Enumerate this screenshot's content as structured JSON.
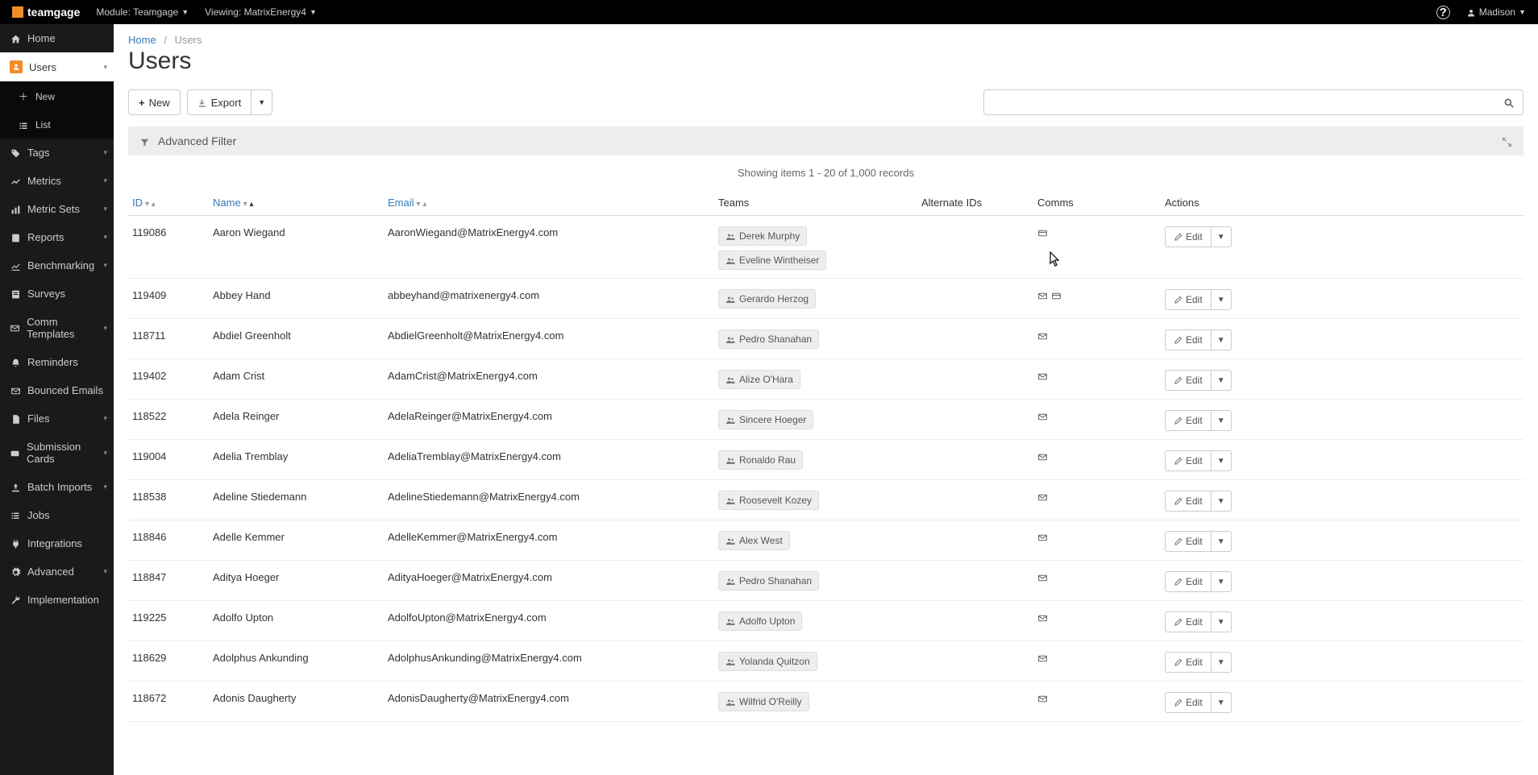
{
  "topbar": {
    "brand": "teamgage",
    "module_label": "Module: Teamgage",
    "viewing_label": "Viewing: MatrixEnergy4",
    "user_name": "Madison"
  },
  "sidebar": {
    "home": "Home",
    "users": "Users",
    "new": "New",
    "list": "List",
    "tags": "Tags",
    "metrics": "Metrics",
    "metric_sets": "Metric Sets",
    "reports": "Reports",
    "benchmarking": "Benchmarking",
    "surveys": "Surveys",
    "comm_templates": "Comm Templates",
    "reminders": "Reminders",
    "bounced_emails": "Bounced Emails",
    "files": "Files",
    "submission_cards": "Submission Cards",
    "batch_imports": "Batch Imports",
    "jobs": "Jobs",
    "integrations": "Integrations",
    "advanced": "Advanced",
    "implementation": "Implementation"
  },
  "breadcrumb": {
    "home": "Home",
    "current": "Users"
  },
  "page_title": "Users",
  "toolbar": {
    "new": "New",
    "export": "Export"
  },
  "filter": {
    "label": "Advanced Filter"
  },
  "records_info": "Showing items 1 - 20 of 1,000 records",
  "columns": {
    "id": "ID",
    "name": "Name",
    "email": "Email",
    "teams": "Teams",
    "altids": "Alternate IDs",
    "comms": "Comms",
    "actions": "Actions"
  },
  "edit_label": "Edit",
  "rows": [
    {
      "id": "119086",
      "name": "Aaron Wiegand",
      "email": "AaronWiegand@MatrixEnergy4.com",
      "teams": [
        "Derek Murphy",
        "Eveline Wintheiser"
      ],
      "comms": [
        "card"
      ]
    },
    {
      "id": "119409",
      "name": "Abbey Hand",
      "email": "abbeyhand@matrixenergy4.com",
      "teams": [
        "Gerardo Herzog"
      ],
      "comms": [
        "mail",
        "card"
      ]
    },
    {
      "id": "118711",
      "name": "Abdiel Greenholt",
      "email": "AbdielGreenholt@MatrixEnergy4.com",
      "teams": [
        "Pedro Shanahan"
      ],
      "comms": [
        "mail"
      ]
    },
    {
      "id": "119402",
      "name": "Adam Crist",
      "email": "AdamCrist@MatrixEnergy4.com",
      "teams": [
        "Alize O'Hara"
      ],
      "comms": [
        "mail"
      ]
    },
    {
      "id": "118522",
      "name": "Adela Reinger",
      "email": "AdelaReinger@MatrixEnergy4.com",
      "teams": [
        "Sincere Hoeger"
      ],
      "comms": [
        "mail"
      ]
    },
    {
      "id": "119004",
      "name": "Adelia Tremblay",
      "email": "AdeliaTremblay@MatrixEnergy4.com",
      "teams": [
        "Ronaldo Rau"
      ],
      "comms": [
        "mail"
      ]
    },
    {
      "id": "118538",
      "name": "Adeline Stiedemann",
      "email": "AdelineStiedemann@MatrixEnergy4.com",
      "teams": [
        "Roosevelt Kozey"
      ],
      "comms": [
        "mail"
      ]
    },
    {
      "id": "118846",
      "name": "Adelle Kemmer",
      "email": "AdelleKemmer@MatrixEnergy4.com",
      "teams": [
        "Alex West"
      ],
      "comms": [
        "mail"
      ]
    },
    {
      "id": "118847",
      "name": "Aditya Hoeger",
      "email": "AdityaHoeger@MatrixEnergy4.com",
      "teams": [
        "Pedro Shanahan"
      ],
      "comms": [
        "mail"
      ]
    },
    {
      "id": "119225",
      "name": "Adolfo Upton",
      "email": "AdolfoUpton@MatrixEnergy4.com",
      "teams": [
        "Adolfo Upton"
      ],
      "comms": [
        "mail"
      ]
    },
    {
      "id": "118629",
      "name": "Adolphus Ankunding",
      "email": "AdolphusAnkunding@MatrixEnergy4.com",
      "teams": [
        "Yolanda Quitzon"
      ],
      "comms": [
        "mail"
      ]
    },
    {
      "id": "118672",
      "name": "Adonis Daugherty",
      "email": "AdonisDaugherty@MatrixEnergy4.com",
      "teams": [
        "Wilfrid O'Reilly"
      ],
      "comms": [
        "mail"
      ]
    }
  ]
}
